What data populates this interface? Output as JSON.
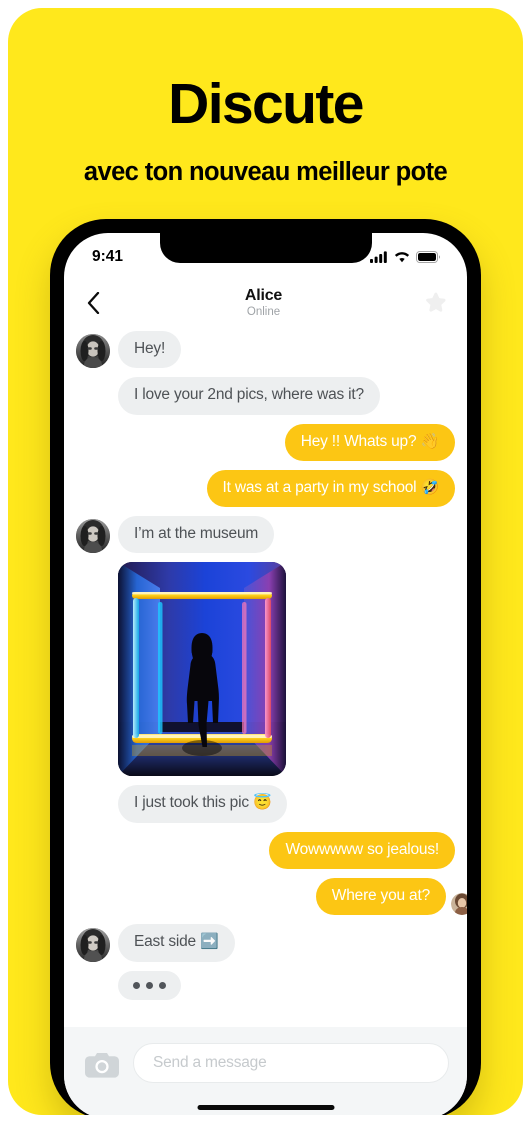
{
  "poster": {
    "background_color": "#FFE81C",
    "headline": "Discute",
    "subheadline": "avec ton nouveau meilleur pote"
  },
  "phone": {
    "status_bar": {
      "time": "9:41",
      "signal_icon": "cellular-signal-icon",
      "wifi_icon": "wifi-icon",
      "battery_icon": "battery-icon"
    },
    "chat_header": {
      "back_icon": "chevron-left-icon",
      "contact_name": "Alice",
      "presence": "Online",
      "star_icon": "star-icon",
      "star_color": "#EFEFEF"
    },
    "messages": [
      {
        "id": 1,
        "side": "in",
        "type": "text",
        "text": "Hey!",
        "avatar": true
      },
      {
        "id": 2,
        "side": "in",
        "type": "text",
        "text": "I love your 2nd pics, where was it?",
        "avatar": false
      },
      {
        "id": 3,
        "side": "out",
        "type": "text",
        "text": "Hey !! Whats up? ",
        "emoji": "👋"
      },
      {
        "id": 4,
        "side": "out",
        "type": "text",
        "text": "It was at a party in my school ",
        "emoji": "🤣"
      },
      {
        "id": 5,
        "side": "in",
        "type": "text",
        "text": "I’m at the museum",
        "avatar": true
      },
      {
        "id": 6,
        "side": "in",
        "type": "photo",
        "alt": "neon-light-installation-photo",
        "avatar": false
      },
      {
        "id": 7,
        "side": "in",
        "type": "text",
        "text": "I just took this pic ",
        "emoji": "😇",
        "avatar": false
      },
      {
        "id": 8,
        "side": "out",
        "type": "text",
        "text": "Wowwwww so jealous!"
      },
      {
        "id": 9,
        "side": "out",
        "type": "text",
        "text": "Where you at?",
        "read_receipt": true
      },
      {
        "id": 10,
        "side": "in",
        "type": "text",
        "text": "East side ",
        "emoji": "➡️",
        "avatar": true
      },
      {
        "id": 11,
        "side": "in",
        "type": "typing",
        "avatar": false
      }
    ],
    "composer": {
      "camera_icon": "camera-icon",
      "placeholder": "Send a message",
      "value": ""
    },
    "colors": {
      "outgoing_bubble": "#FCC614",
      "incoming_bubble": "#EDEFF0",
      "incoming_text": "#4E5256",
      "outgoing_text": "#FFFFFF",
      "composer_background": "#F4F6F7"
    }
  }
}
